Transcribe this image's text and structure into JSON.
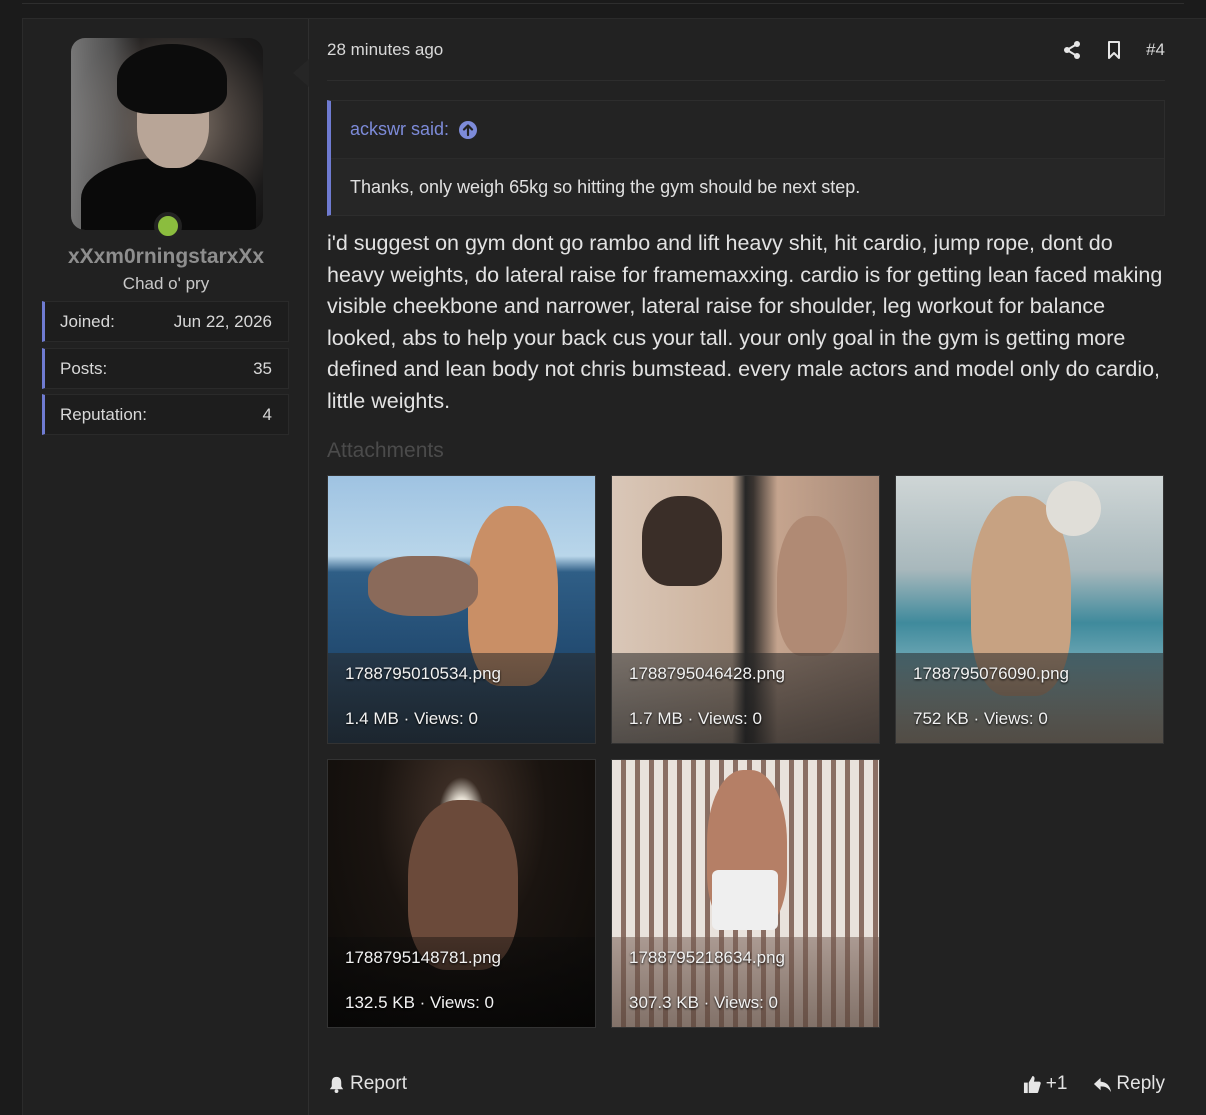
{
  "post": {
    "timestamp": "28 minutes ago",
    "post_number": "#4",
    "user": {
      "username": "xXxm0rningstarxXx",
      "title": "Chad o' pry",
      "online_color": "#8bbd3e",
      "stats": [
        {
          "label": "Joined:",
          "value": "Jun 22, 2026"
        },
        {
          "label": "Posts:",
          "value": "35"
        },
        {
          "label": "Reputation:",
          "value": "4"
        }
      ]
    },
    "quote": {
      "author_line": "ackswr said:",
      "text": "Thanks, only weigh 65kg so hitting the gym should be next step."
    },
    "message": "i'd suggest on gym dont go rambo and lift heavy shit, hit cardio, jump rope, dont do heavy weights, do lateral raise for framemaxxing. cardio is for getting lean faced making visible cheekbone and narrower, lateral raise for shoulder, leg workout for balance looked, abs to help your back cus your tall. your only goal in the gym is getting more defined and lean body not chris bumstead. every male actors and model only do cardio, little weights.",
    "attachments_label": "Attachments",
    "attachments": [
      {
        "filename": "1788795010534.png",
        "meta": "1.4 MB · Views: 0"
      },
      {
        "filename": "1788795046428.png",
        "meta": "1.7 MB · Views: 0"
      },
      {
        "filename": "1788795076090.png",
        "meta": "752 KB · Views: 0"
      },
      {
        "filename": "1788795148781.png",
        "meta": "132.5 KB · Views: 0"
      },
      {
        "filename": "1788795218634.png",
        "meta": "307.3 KB · Views: 0"
      }
    ],
    "footer": {
      "report_label": "Report",
      "like_count": "+1",
      "reply_label": "Reply"
    }
  },
  "icons": {
    "share": "share-icon",
    "bookmark": "bookmark-icon",
    "quote_link": "arrow-up-circle-icon",
    "report": "bell-icon",
    "like": "thumbs-up-icon",
    "reply": "reply-icon"
  },
  "colors": {
    "accent": "#6f7bd1",
    "quote_author": "#7d8bd9",
    "online": "#8bbd3e"
  }
}
